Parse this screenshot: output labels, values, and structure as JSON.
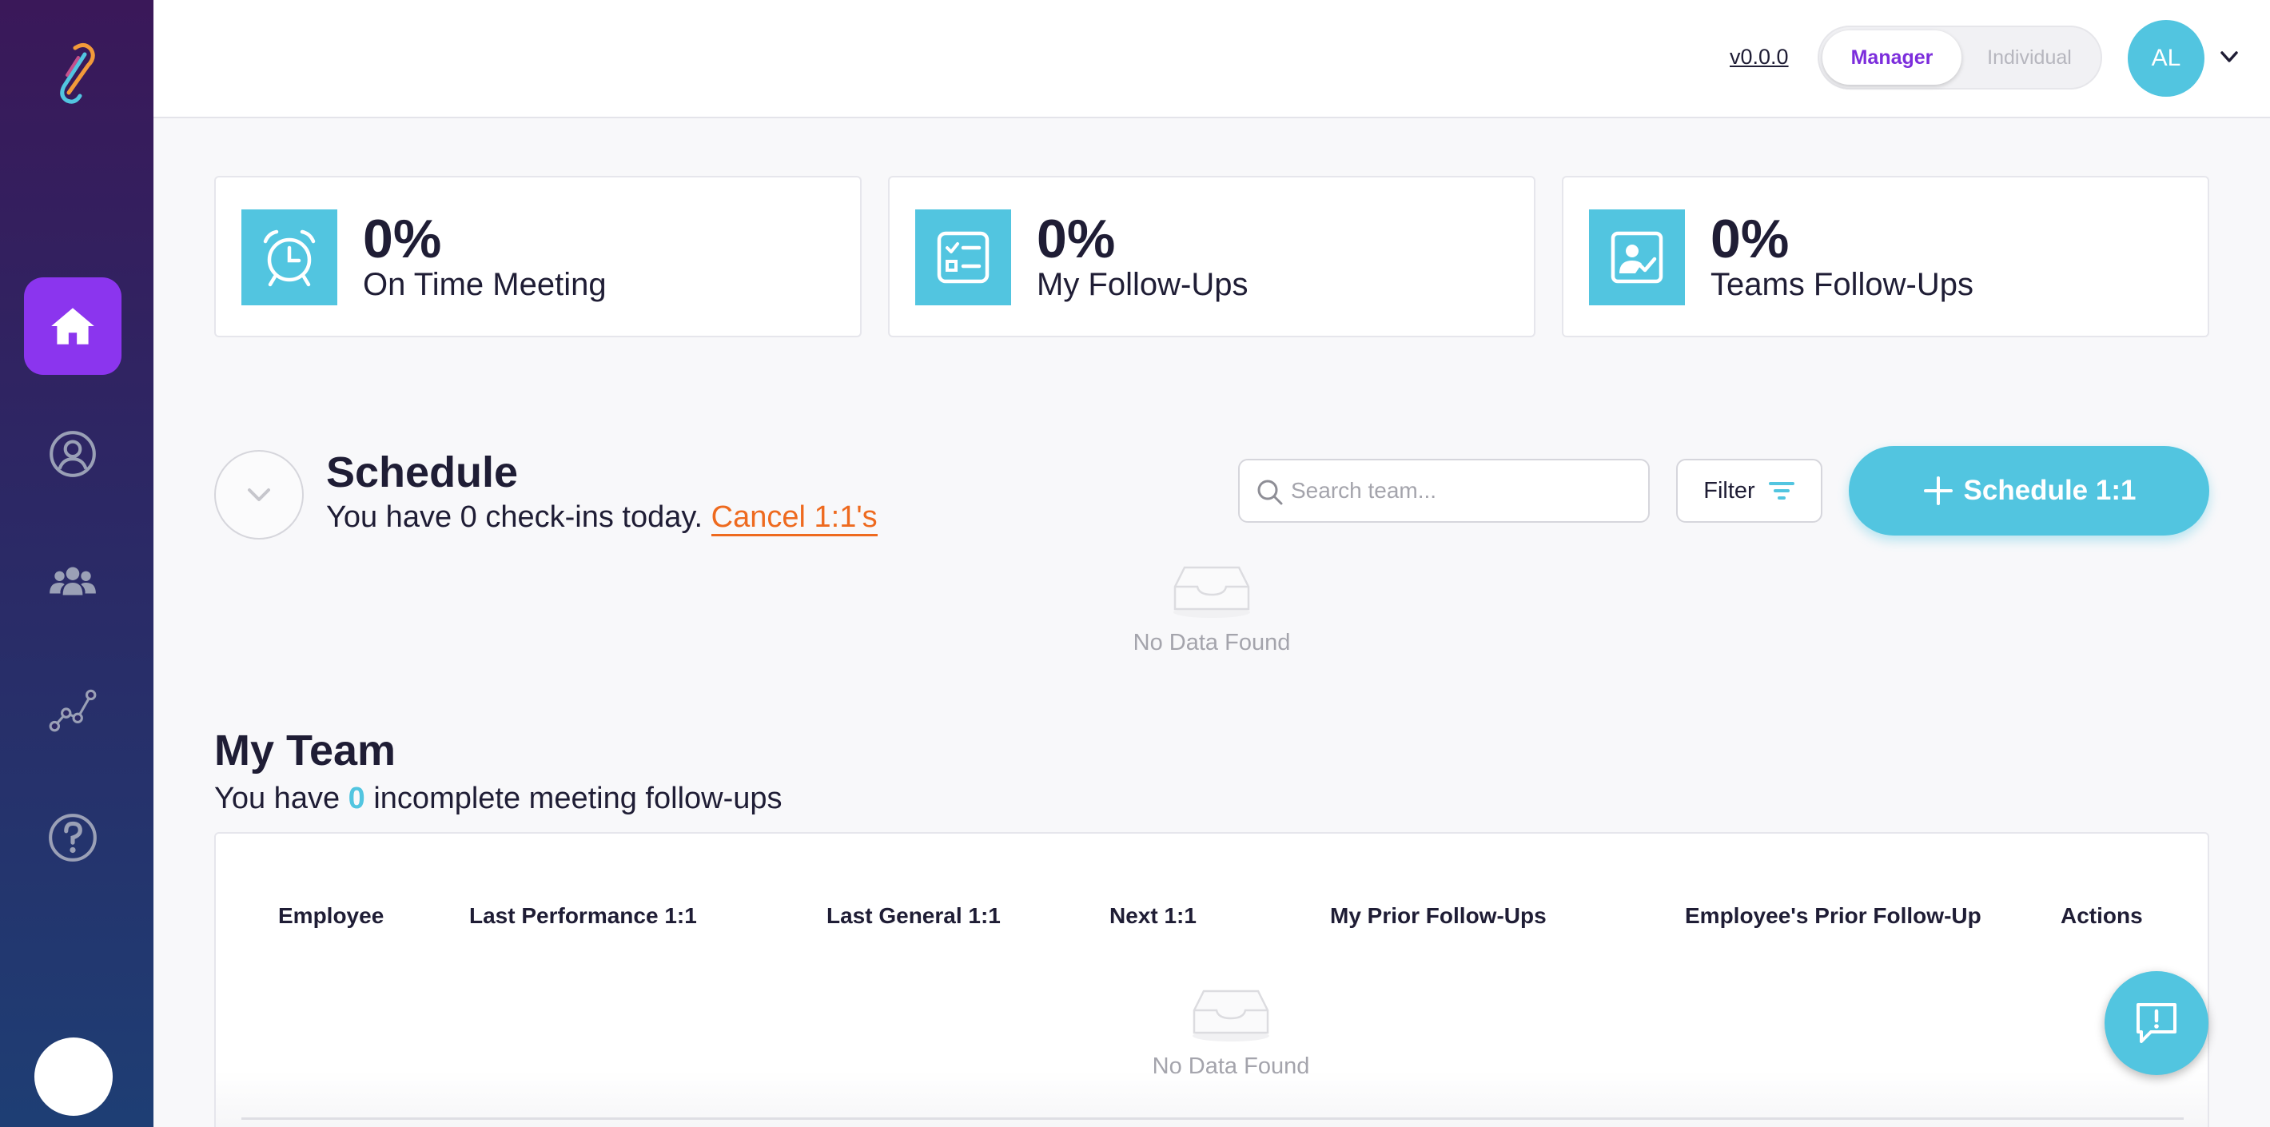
{
  "app": {
    "version": "v0.0.0"
  },
  "role_toggle": {
    "active": "Manager",
    "inactive": "Individual"
  },
  "user": {
    "initials": "AL"
  },
  "sidebar": {
    "items": [
      {
        "icon": "home-icon",
        "active": true
      },
      {
        "icon": "user-icon",
        "active": false
      },
      {
        "icon": "users-icon",
        "active": false
      },
      {
        "icon": "analytics-icon",
        "active": false
      },
      {
        "icon": "help-icon",
        "active": false
      }
    ]
  },
  "stats": [
    {
      "value": "0%",
      "label": "On Time Meeting",
      "icon": "alarm-clock-icon"
    },
    {
      "value": "0%",
      "label": "My Follow-Ups",
      "icon": "checklist-icon"
    },
    {
      "value": "0%",
      "label": "Teams Follow-Ups",
      "icon": "team-check-icon"
    }
  ],
  "schedule": {
    "title": "Schedule",
    "subtitle_prefix": "You have 0 check-ins today.",
    "cancel_link": "Cancel 1:1's",
    "search_placeholder": "Search team...",
    "filter_label": "Filter",
    "schedule_button": "Schedule 1:1",
    "empty_text": "No Data Found"
  },
  "team": {
    "title": "My Team",
    "subtitle_prefix": "You have",
    "count": "0",
    "subtitle_suffix": "incomplete meeting follow-ups",
    "columns": [
      "Employee",
      "Last Performance 1:1",
      "Last General 1:1",
      "Next 1:1",
      "My Prior Follow-Ups",
      "Employee's Prior Follow-Up",
      "Actions"
    ],
    "empty_text": "No Data Found"
  },
  "colors": {
    "accent": "#52c5e0",
    "primary": "#8b35ee",
    "link": "#ee6a1f",
    "text": "#1f1d35"
  }
}
